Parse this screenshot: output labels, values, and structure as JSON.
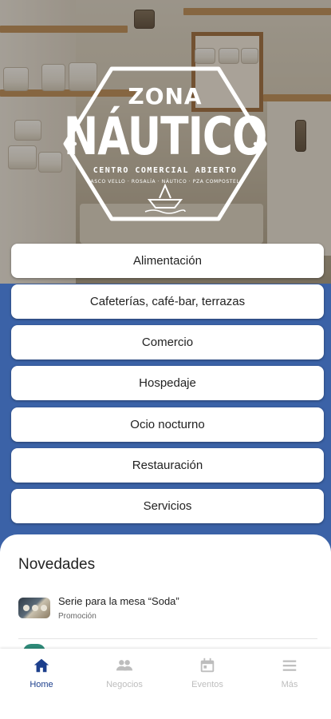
{
  "brand": {
    "logo_word_top": "ZONA",
    "logo_word_main": "NÁUTICO",
    "logo_subtitle": "CENTRO COMERCIAL ABIERTO",
    "logo_places": "CASCO VELLO · ROSALÍA · NÁUTICO · PZA COMPOSTELA"
  },
  "categories": [
    {
      "label": "Alimentación"
    },
    {
      "label": "Cafeterías, café-bar, terrazas"
    },
    {
      "label": "Comercio"
    },
    {
      "label": "Hospedaje"
    },
    {
      "label": "Ocio nocturno"
    },
    {
      "label": "Restauración"
    },
    {
      "label": "Servicios"
    }
  ],
  "news": {
    "title": "Novedades",
    "items": [
      {
        "title": "Serie para la mesa “Soda”",
        "tag": "Promoción"
      }
    ]
  },
  "nav": {
    "items": [
      {
        "label": "Home",
        "icon": "home-icon",
        "active": true
      },
      {
        "label": "Negocios",
        "icon": "people-icon",
        "active": false
      },
      {
        "label": "Eventos",
        "icon": "calendar-icon",
        "active": false
      },
      {
        "label": "Más",
        "icon": "menu-icon",
        "active": false
      }
    ]
  },
  "colors": {
    "primary": "#3b62a7",
    "nav_active": "#1c3f8c",
    "nav_inactive": "#bdbdbd"
  }
}
